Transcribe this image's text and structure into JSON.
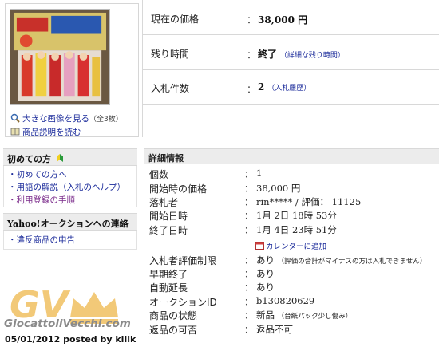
{
  "left": {
    "links": [
      {
        "label": "大きな画像を見る",
        "count": "（全3枚）",
        "icon": "magnifier-icon"
      },
      {
        "label": "商品説明を読む",
        "count": "",
        "icon": "book-icon"
      }
    ],
    "beginners": {
      "title": "初めての方",
      "items": [
        "・初めての方へ",
        "・用語の解説（入札のヘルプ）",
        "・利用登録の手順"
      ]
    },
    "contact": {
      "title": "Yahoo!オークションへの連絡",
      "items": [
        "・違反商品の申告"
      ]
    }
  },
  "top": {
    "rows": [
      {
        "label": "現在の価格",
        "colon": "：",
        "value": "38,000 円",
        "sub": ""
      },
      {
        "label": "残り時間",
        "colon": "：",
        "value": "終了",
        "sub": "（詳細な残り時間）"
      },
      {
        "label": "入札件数",
        "colon": "：",
        "value": "2",
        "sub": "（入札履歴）"
      }
    ]
  },
  "details": {
    "title": "詳細情報",
    "rows": [
      {
        "label": "個数",
        "value": "1",
        "note": ""
      },
      {
        "label": "開始時の価格",
        "value": "38,000 円",
        "note": ""
      },
      {
        "label": "落札者",
        "value": "rin***** / 評価： 11125",
        "note": ""
      },
      {
        "label": "開始日時",
        "value": "1月 2日 18時 53分",
        "note": ""
      },
      {
        "label": "終了日時",
        "value": "1月 4日 23時 51分",
        "note": ""
      },
      {
        "label": "入札者評価制限",
        "value": "あり",
        "note": "（評価の合計がマイナスの方は入札できません）"
      },
      {
        "label": "早期終了",
        "value": "あり",
        "note": ""
      },
      {
        "label": "自動延長",
        "value": "あり",
        "note": ""
      },
      {
        "label": "オークションID",
        "value": "b130820629",
        "note": ""
      },
      {
        "label": "商品の状態",
        "value": "新品",
        "note": "（台紙パック少し傷み）"
      },
      {
        "label": "返品の可否",
        "value": "返品不可",
        "note": ""
      }
    ],
    "colon": "：",
    "calendar": "カレンダーに追加"
  },
  "watermark": {
    "logo_text": "GV",
    "site": "GiocattoliVecchi.com",
    "posted": "05/01/2012 posted by kilik"
  },
  "colors": {
    "link": "#1a2a9a",
    "header_bg": "#ececec",
    "watermark": "#f0c060"
  }
}
